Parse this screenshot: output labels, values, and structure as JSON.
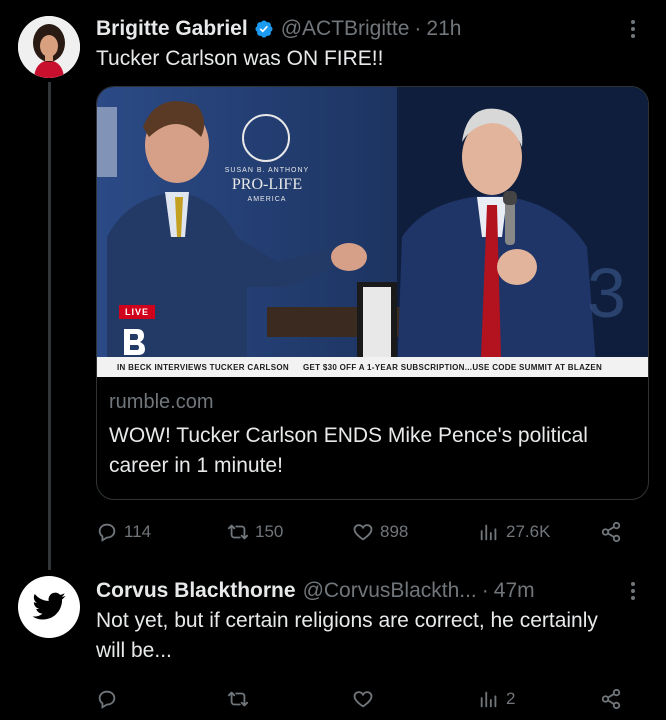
{
  "tweet1": {
    "name": "Brigitte Gabriel",
    "handle": "@ACTBrigitte",
    "dot": "·",
    "time": "21h",
    "text": "Tucker Carlson was ON FIRE!!",
    "card": {
      "domain": "rumble.com",
      "title": "WOW! Tucker Carlson ENDS Mike Pence's political career in 1 minute!",
      "live_badge": "LIVE",
      "ticker_left": "IN BECK INTERVIEWS TUCKER CARLSON",
      "ticker_right": "GET $30 OFF A 1-YEAR SUBSCRIPTION...USE CODE SUMMIT AT BLAZEN",
      "backdrop_small1": "SUSAN B. ANTHONY",
      "backdrop_big": "PRO-LIFE",
      "backdrop_small2": "AMERICA"
    },
    "actions": {
      "replies": "114",
      "retweets": "150",
      "likes": "898",
      "views": "27.6K"
    }
  },
  "tweet2": {
    "name": "Corvus Blackthorne",
    "handle": "@CorvusBlackth...",
    "dot": "·",
    "time": "47m",
    "text": "Not yet, but if certain religions are correct, he certainly will be...",
    "actions": {
      "replies": "",
      "retweets": "",
      "likes": "",
      "views": "2"
    }
  },
  "colors": {
    "background": "#000000",
    "text": "#e7e9ea",
    "muted": "#71767b",
    "verified": "#1d9bf0",
    "border": "#2f3336"
  }
}
